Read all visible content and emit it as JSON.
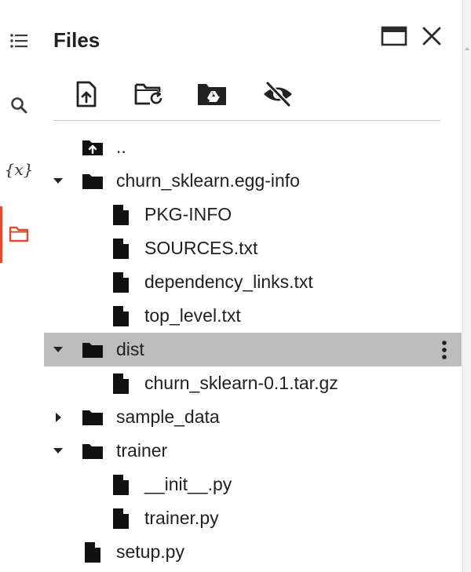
{
  "panel": {
    "title": "Files"
  },
  "rail": {
    "items": [
      {
        "name": "table-of-contents",
        "icon": "list-icon"
      },
      {
        "name": "search",
        "icon": "search-icon"
      },
      {
        "name": "variables",
        "icon": "variables-icon",
        "label": "{x}"
      },
      {
        "name": "files",
        "icon": "folder-icon",
        "active": true
      }
    ],
    "active_color": "#e04a2f"
  },
  "header_buttons": [
    {
      "name": "open-in-tab",
      "icon": "window-icon"
    },
    {
      "name": "close",
      "icon": "close-icon"
    }
  ],
  "toolbar": [
    {
      "name": "upload",
      "icon": "upload-file-icon"
    },
    {
      "name": "refresh",
      "icon": "folder-refresh-icon"
    },
    {
      "name": "mount-drive",
      "icon": "drive-folder-icon"
    },
    {
      "name": "toggle-hidden",
      "icon": "eye-off-icon"
    }
  ],
  "tree": [
    {
      "label": "..",
      "type": "parent",
      "level": 0
    },
    {
      "label": "churn_sklearn.egg-info",
      "type": "folder",
      "level": 0,
      "expanded": true
    },
    {
      "label": "PKG-INFO",
      "type": "file",
      "level": 1
    },
    {
      "label": "SOURCES.txt",
      "type": "file",
      "level": 1
    },
    {
      "label": "dependency_links.txt",
      "type": "file",
      "level": 1
    },
    {
      "label": "top_level.txt",
      "type": "file",
      "level": 1
    },
    {
      "label": "dist",
      "type": "folder",
      "level": 0,
      "expanded": true,
      "selected": true
    },
    {
      "label": "churn_sklearn-0.1.tar.gz",
      "type": "file",
      "level": 1
    },
    {
      "label": "sample_data",
      "type": "folder",
      "level": 0,
      "expanded": false
    },
    {
      "label": "trainer",
      "type": "folder",
      "level": 0,
      "expanded": true
    },
    {
      "label": "__init__.py",
      "type": "file",
      "level": 1
    },
    {
      "label": "trainer.py",
      "type": "file",
      "level": 1
    },
    {
      "label": "setup.py",
      "type": "file",
      "level": 0
    }
  ],
  "colors": {
    "selected_row": "#bdbdbd",
    "accent": "#e04a2f"
  }
}
